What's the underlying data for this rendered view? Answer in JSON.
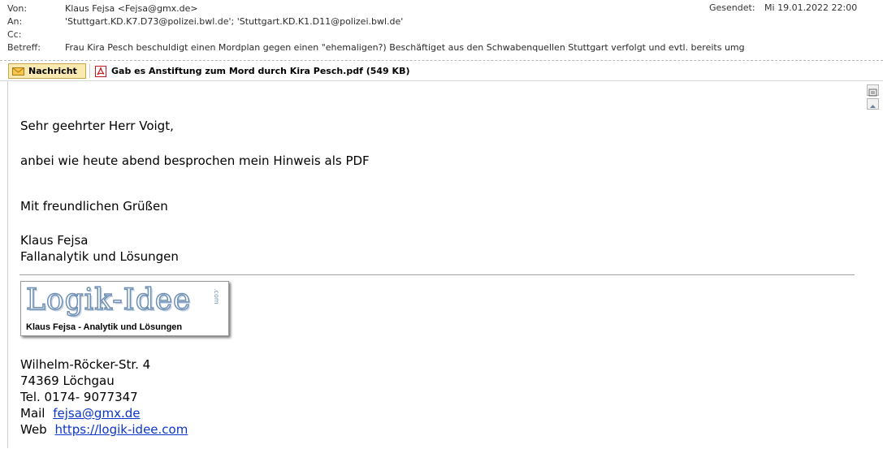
{
  "header": {
    "from_label": "Von:",
    "from_value": "Klaus Fejsa <Fejsa@gmx.de>",
    "to_label": "An:",
    "to_value": "'Stuttgart.KD.K7.D73@polizei.bwl.de'; 'Stuttgart.KD.K1.D11@polizei.bwl.de'",
    "cc_label": "Cc:",
    "cc_value": "",
    "subject_label": "Betreff:",
    "subject_value": "Frau Kira Pesch beschuldigt einen Mordplan gegen einen \"ehemaligen?) Beschäftiget aus den Schwabenquellen Stuttgart verfolgt und evtl. bereits umg",
    "sent_label": "Gesendet:",
    "sent_value": "Mi 19.01.2022 22:00"
  },
  "attachments": {
    "message_tab_label": "Nachricht",
    "file_label": "Gab es Anstiftung zum Mord durch Kira Pesch.pdf (549 KB)"
  },
  "body": {
    "greeting": "Sehr geehrter Herr Voigt,",
    "text": "anbei wie heute abend besprochen mein Hinweis als PDF",
    "closing": "Mit freundlichen Grüßen",
    "name": "Klaus Fejsa",
    "title": "Fallanalytik und Lösungen"
  },
  "signature": {
    "logo_text": "Logik-Idee",
    "logo_small": ".com",
    "logo_tagline": "Klaus Fejsa  -  Analytik und Lösungen",
    "street": "Wilhelm-Röcker-Str.  4",
    "city": "74369 Löchgau",
    "phone": "Tel.  0174- 9077347",
    "mail_label": "Mail",
    "mail_value": "fejsa@gmx.de",
    "web_label": "Web",
    "web_value": "https://logik-idee.com"
  },
  "colors": {
    "link": "#0b35c8",
    "tab_bg": "#fbe9b2",
    "logo_blue": "#6f8fb3"
  },
  "icons": {
    "message_tab": "envelope-icon",
    "attachment": "pdf-icon",
    "scroll": "scroll-up-icon"
  }
}
